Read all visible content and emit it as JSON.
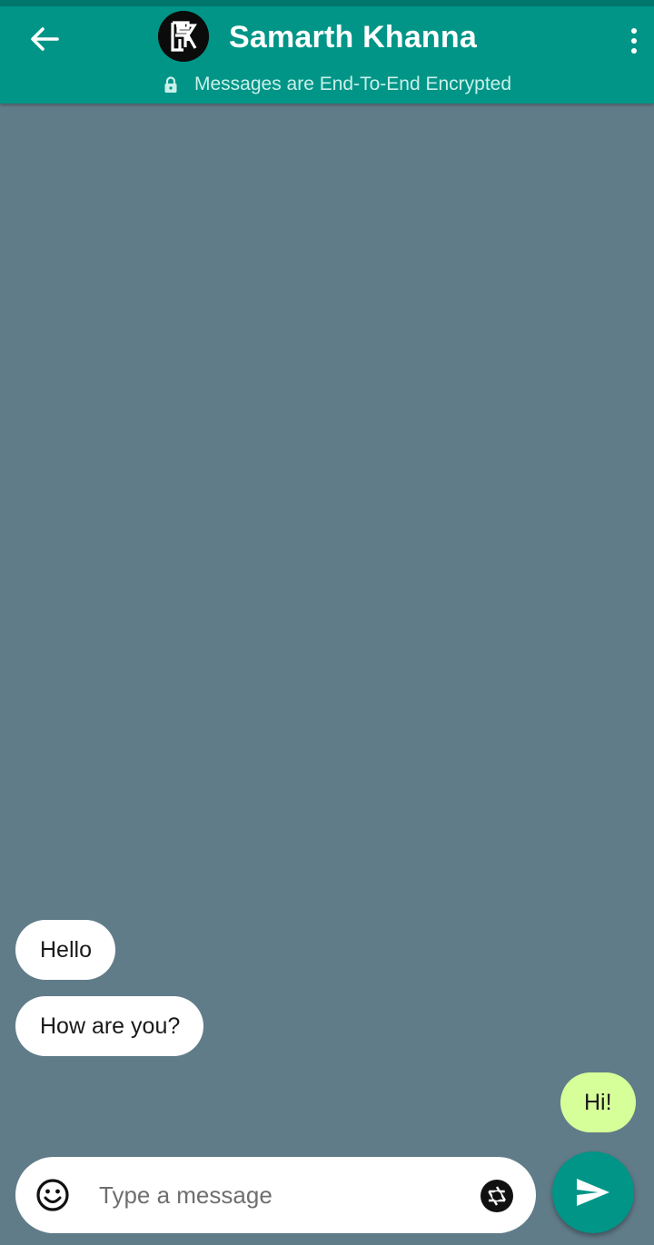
{
  "header": {
    "back_icon": "arrow-left-icon",
    "avatar_icon": "sk-monogram-logo",
    "contact_name": "Samarth Khanna",
    "encryption_notice": "Messages are End-To-End Encrypted",
    "lock_icon": "lock-icon",
    "menu_icon": "more-vertical-icon",
    "color": "#009587"
  },
  "messages": [
    {
      "text": "Hello",
      "direction": "received"
    },
    {
      "text": "How are you?",
      "direction": "received"
    },
    {
      "text": "Hi!",
      "direction": "sent"
    }
  ],
  "composer": {
    "placeholder": "Type a message",
    "value": "",
    "emoji_icon": "smiley-icon",
    "camera_icon": "camera-shutter-icon",
    "send_icon": "send-icon"
  },
  "colors": {
    "chat_background": "#617c89",
    "sent_bubble": "#d6ff99",
    "received_bubble": "#ffffff",
    "accent": "#009587"
  }
}
